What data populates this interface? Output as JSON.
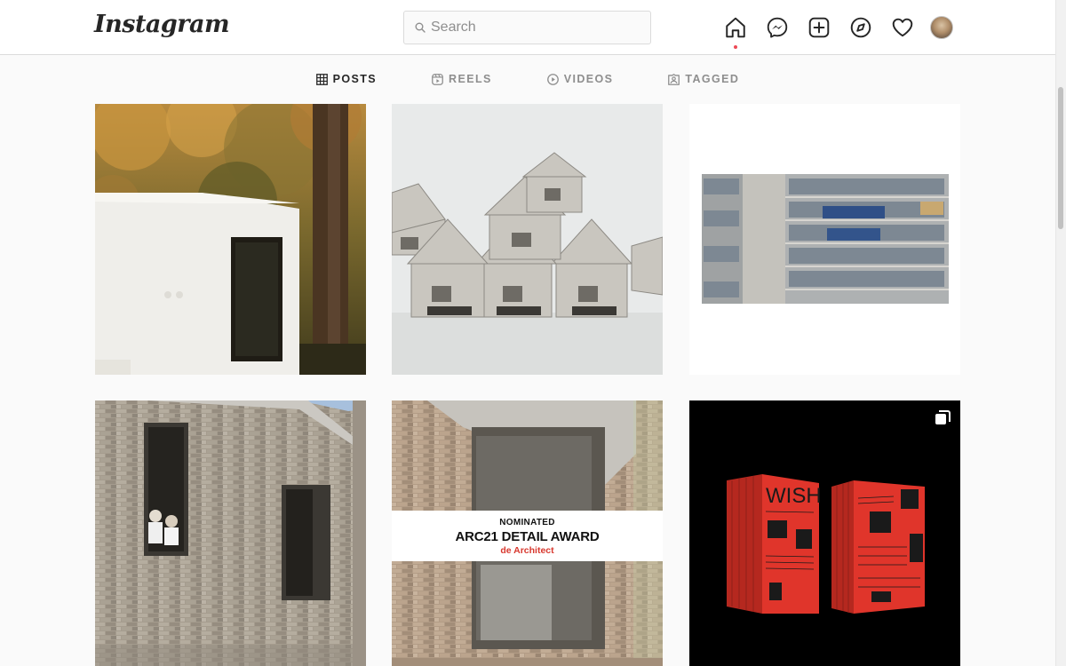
{
  "header": {
    "logo": "Instagram",
    "search_placeholder": "Search",
    "icons": [
      "home-icon",
      "messenger-icon",
      "new-post-icon",
      "explore-icon",
      "activity-heart-icon",
      "profile-avatar"
    ]
  },
  "tabs": [
    {
      "label": "POSTS",
      "icon": "grid-icon",
      "active": true
    },
    {
      "label": "REELS",
      "icon": "reels-icon",
      "active": false
    },
    {
      "label": "VIDEOS",
      "icon": "play-icon",
      "active": false
    },
    {
      "label": "TAGGED",
      "icon": "tagged-icon",
      "active": false
    }
  ],
  "posts": [
    {
      "type": "photo"
    },
    {
      "type": "photo"
    },
    {
      "type": "photo"
    },
    {
      "type": "photo"
    },
    {
      "type": "photo",
      "overlay": {
        "line1": "NOMINATED",
        "line2": "ARC21 DETAIL AWARD",
        "line3": "de Architect"
      }
    },
    {
      "type": "carousel",
      "book_title": "WISH"
    }
  ],
  "colors": {
    "accent_dot": "#ed4956",
    "award_red": "#d8382e",
    "book_red": "#e0352b"
  }
}
